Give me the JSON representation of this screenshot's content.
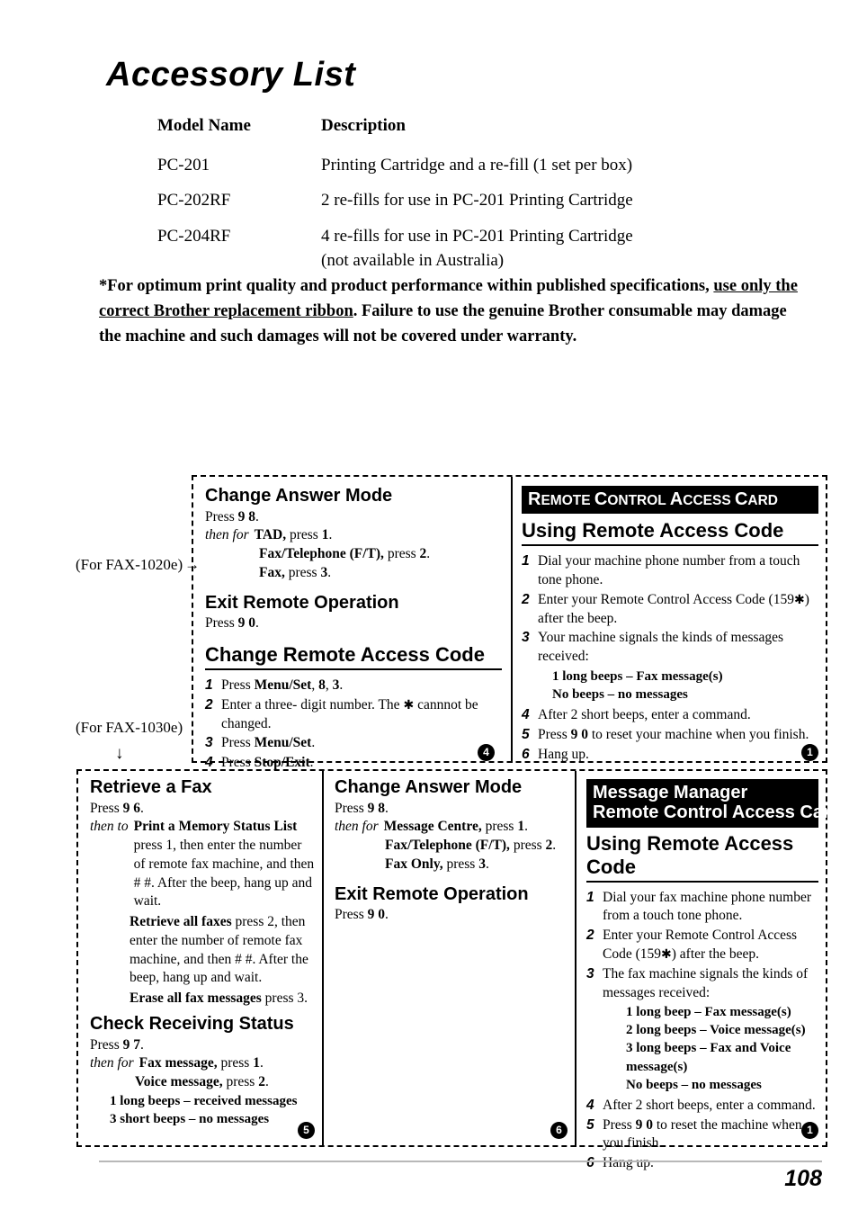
{
  "page": {
    "title": "Accessory List",
    "number": "108"
  },
  "accessory_table": {
    "headers": {
      "model": "Model Name",
      "description": "Description"
    },
    "rows": [
      {
        "model": "PC-201",
        "description": "Printing Cartridge and a re-fill (1 set per box)",
        "description_line2": ""
      },
      {
        "model": "PC-202RF",
        "description": "2 re-fills for use in PC-201 Printing Cartridge",
        "description_line2": ""
      },
      {
        "model": "PC-204RF",
        "description": "4 re-fills for use in PC-201 Printing Cartridge",
        "description_line2": "(not available in Australia)"
      }
    ]
  },
  "note": {
    "part1": "*For optimum print quality and product performance within published specifications, ",
    "underlined": "use only the correct Brother replacement ribbon",
    "part2": ". Failure to use the genuine Brother consumable may damage the machine and such damages will not be covered under warranty."
  },
  "side_labels": {
    "fax_1020e": "(For FAX-1020e)",
    "arrow_right": "→",
    "fax_1030e": "(For FAX-1030e)",
    "arrow_down": "↓"
  },
  "piece_numbers": {
    "row1_middle": "4",
    "row1_right": "1",
    "row2_left": "5",
    "row2_middle": "6",
    "row2_right": "1"
  },
  "card_r1_left": {
    "heading_answer_mode": "Change Answer Mode",
    "press_98": {
      "pre": "Press ",
      "keys": "9 8",
      "post": "."
    },
    "then_for_label": "then for",
    "options": [
      {
        "name": "TAD,",
        "press": " press ",
        "key": "1",
        "end": "."
      },
      {
        "name": "Fax/Telephone (F/T),",
        "press": " press ",
        "key": "2",
        "end": "."
      },
      {
        "name": "Fax,",
        "press": " press ",
        "key": "3",
        "end": "."
      }
    ],
    "heading_exit": "Exit Remote Operation",
    "press_90": {
      "pre": "Press ",
      "keys": "9 0",
      "post": "."
    },
    "heading_change_code": "Change Remote Access Code",
    "steps": [
      {
        "n": "1",
        "pre": "Press ",
        "b1": "Menu/Set",
        "mid": ", ",
        "b2": "8",
        "mid2": ", ",
        "b3": "3",
        "post": "."
      },
      {
        "n": "2",
        "text_a": "Enter a three- digit number. The ",
        "asterisk": "✱",
        "text_b": " cannnot be changed."
      },
      {
        "n": "3",
        "pre": "Press ",
        "b1": "Menu/Set",
        "post": "."
      },
      {
        "n": "4",
        "pre": "Press ",
        "b1": "Stop/Exit",
        "post": "."
      }
    ]
  },
  "card_r1_right": {
    "banner_lines": [
      {
        "cap": "R",
        "rest": "EMOTE "
      },
      {
        "cap": "C",
        "rest": "ONTROL "
      },
      {
        "cap": "A",
        "rest": "CCESS "
      },
      {
        "cap": "C",
        "rest": "ARD"
      }
    ],
    "banner_text": "Remote Control Access Card",
    "heading": "Using Remote Access Code",
    "steps": [
      {
        "n": "1",
        "text": "Dial your machine phone number from a touch tone phone."
      },
      {
        "n": "2",
        "text_a": "Enter your Remote Control Access Code (159",
        "asterisk": "✱",
        "text_b": ") after the beep."
      },
      {
        "n": "3",
        "text": "Your machine signals the kinds of messages received:"
      },
      {
        "n": "4",
        "text": "After 2 short beeps, enter a command."
      },
      {
        "n": "5",
        "pre": "Press ",
        "keys": "9 0",
        "post": " to reset your machine when you finish."
      },
      {
        "n": "6",
        "text": "Hang up."
      }
    ],
    "beep_lines": [
      "1 long beeps – Fax message(s)",
      "No beeps – no messages"
    ]
  },
  "card_r2_left": {
    "heading_retrieve": "Retrieve a Fax",
    "press_96": {
      "pre": "Press ",
      "keys": "9 6",
      "post": "."
    },
    "then_to_label": "then to",
    "retrieve_options": [
      {
        "name": "Print a Memory Status List",
        "body": " press 1, then enter the number of remote fax machine, and then # #. After the beep, hang up and wait."
      },
      {
        "name": "Retrieve all faxes",
        "body": " press 2, then enter the number of remote fax machine, and then # #. After the beep, hang up and wait."
      },
      {
        "name": "Erase all fax messages",
        "body": " press 3."
      }
    ],
    "heading_check": "Check Receiving Status",
    "press_97": {
      "pre": "Press ",
      "keys": "9 7",
      "post": "."
    },
    "then_for_label": "then for",
    "status_options": [
      {
        "name": "Fax message,",
        "press": " press ",
        "key": "1",
        "end": "."
      },
      {
        "name": "Voice message,",
        "press": " press ",
        "key": "2",
        "end": "."
      }
    ],
    "beep_lines": [
      "1 long beeps – received messages",
      "3 short beeps – no messages"
    ]
  },
  "card_r2_mid": {
    "heading_answer_mode": "Change Answer Mode",
    "press_98": {
      "pre": "Press ",
      "keys": "9 8",
      "post": "."
    },
    "then_for_label": "then for",
    "options": [
      {
        "name": "Message Centre,",
        "press": " press ",
        "key": "1",
        "end": "."
      },
      {
        "name": "Fax/Telephone (F/T),",
        "press": " press ",
        "key": "2",
        "end": "."
      },
      {
        "name": "Fax Only,",
        "press": " press ",
        "key": "3",
        "end": "."
      }
    ],
    "heading_exit": "Exit Remote Operation",
    "press_90": {
      "pre": "Press ",
      "keys": "9 0",
      "post": "."
    }
  },
  "card_r2_right": {
    "banner_line1": "Message Manager",
    "banner_line2": "Remote Control Access Card",
    "heading": "Using Remote Access Code",
    "steps": [
      {
        "n": "1",
        "text": "Dial your fax machine phone number from a touch tone phone."
      },
      {
        "n": "2",
        "text_a": "Enter your Remote Control Access Code (159",
        "asterisk": "✱",
        "text_b": ") after the beep."
      },
      {
        "n": "3",
        "text": "The fax machine signals the kinds of messages received:"
      },
      {
        "n": "4",
        "text": "After 2 short beeps, enter a command."
      },
      {
        "n": "5",
        "pre": "Press ",
        "keys": "9 0",
        "post": " to reset the machine when you finish."
      },
      {
        "n": "6",
        "text": "Hang up."
      }
    ],
    "beep_lines": [
      "1 long beep – Fax message(s)",
      "2 long beeps – Voice message(s)",
      "3 long beeps – Fax and Voice message(s)",
      "No beeps – no messages"
    ]
  }
}
